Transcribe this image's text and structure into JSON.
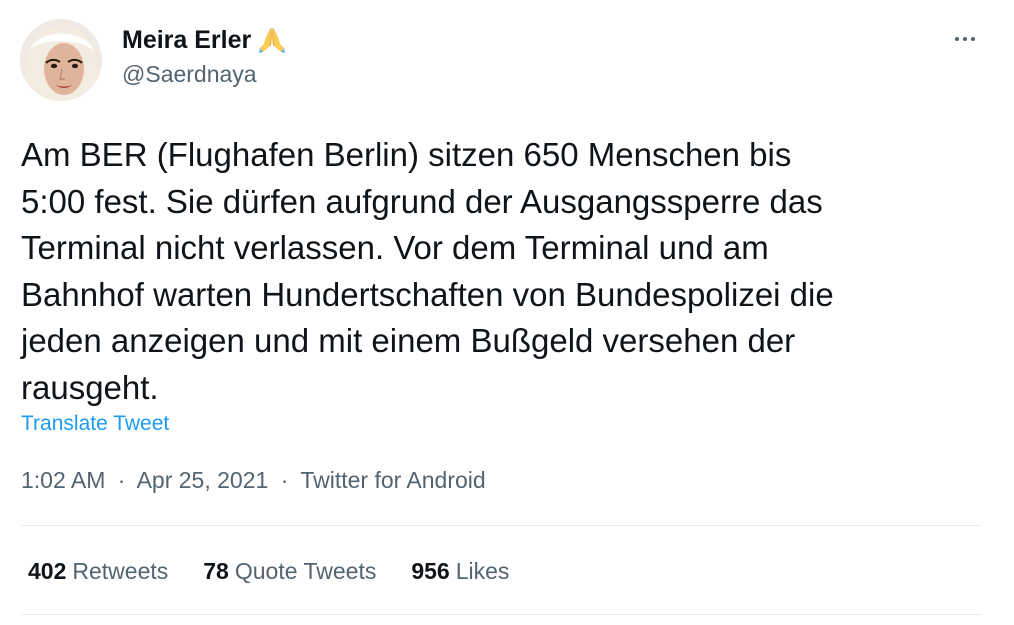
{
  "author": {
    "display_name": "Meira Erler",
    "handle": "@Saerdnaya",
    "badge_emoji": "folded-hands-emoji"
  },
  "tweet": {
    "text": "Am BER (Flughafen Berlin) sitzen 650 Menschen bis\n5:00 fest. Sie dürfen aufgrund der Ausgangssperre das\nTerminal nicht verlassen. Vor dem Terminal und am\nBahnhof warten Hundertschaften von Bundespolizei die\njeden anzeigen und mit einem Bußgeld versehen der\nrausgeht.",
    "translate_label": "Translate Tweet"
  },
  "meta": {
    "time": "1:02 AM",
    "separator": "·",
    "date": "Apr 25, 2021",
    "source": "Twitter for Android"
  },
  "stats": {
    "retweets_count": "402",
    "retweets_label": "Retweets",
    "quotes_count": "78",
    "quotes_label": "Quote Tweets",
    "likes_count": "956",
    "likes_label": "Likes"
  },
  "colors": {
    "link": "#1d9bf0",
    "secondary_text": "#536471",
    "primary_text": "#0f1419",
    "divider": "#e6ecf0"
  },
  "icons": {
    "more": "more-horizontal-icon"
  }
}
